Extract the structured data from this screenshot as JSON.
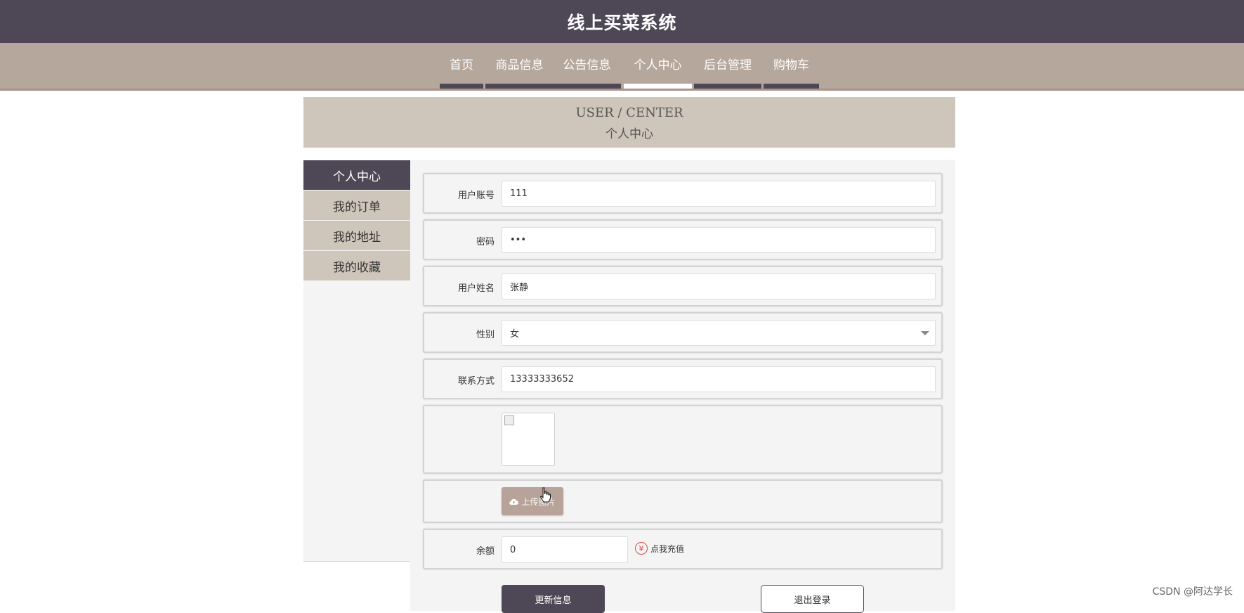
{
  "header": {
    "title": "线上买菜系统"
  },
  "nav": {
    "items": [
      {
        "label": "首页",
        "active": false
      },
      {
        "label": "商品信息",
        "active": false
      },
      {
        "label": "公告信息",
        "active": false
      },
      {
        "label": "个人中心",
        "active": true
      },
      {
        "label": "后台管理",
        "active": false
      },
      {
        "label": "购物车",
        "active": false
      }
    ]
  },
  "banner": {
    "en": "USER / CENTER",
    "cn": "个人中心"
  },
  "sidebar": {
    "items": [
      {
        "label": "个人中心",
        "active": true
      },
      {
        "label": "我的订单",
        "active": false
      },
      {
        "label": "我的地址",
        "active": false
      },
      {
        "label": "我的收藏",
        "active": false
      }
    ]
  },
  "form": {
    "account": {
      "label": "用户账号",
      "value": "111"
    },
    "password": {
      "label": "密码",
      "value": "•••"
    },
    "name": {
      "label": "用户姓名",
      "value": "张静"
    },
    "gender": {
      "label": "性别",
      "value": "女"
    },
    "phone": {
      "label": "联系方式",
      "value": "13333333652"
    },
    "upload_label": "上传图片",
    "balance": {
      "label": "余额",
      "value": "0"
    },
    "recharge_label": "点我充值",
    "update_button": "更新信息",
    "logout_button": "退出登录"
  },
  "watermark": "CSDN @阿达学长",
  "colors": {
    "primary": "#4e4856",
    "accent": "#b6a79c",
    "banner": "#cfc6bb"
  }
}
